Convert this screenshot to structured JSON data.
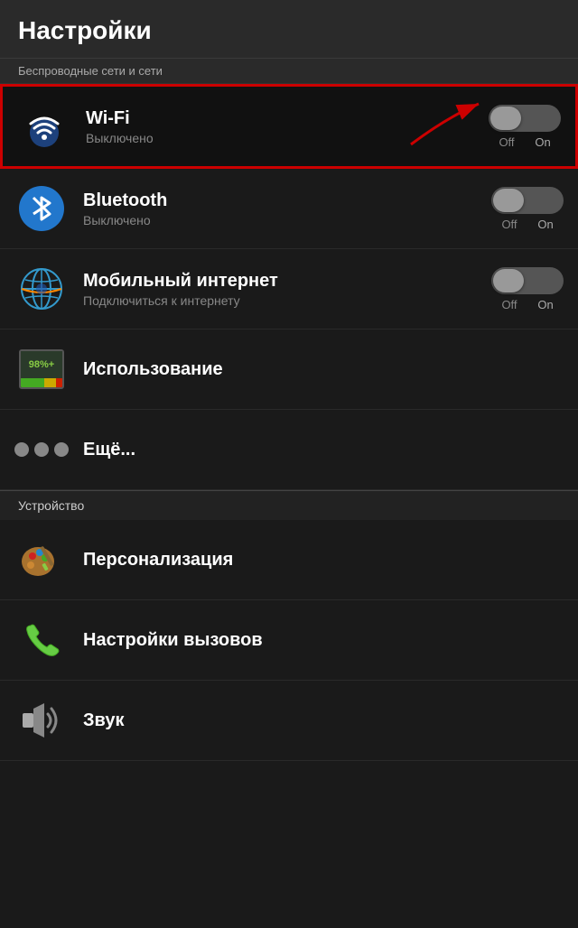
{
  "header": {
    "title": "Настройки"
  },
  "wireless_section": {
    "label": "Беспроводные сети и сети"
  },
  "items": {
    "wifi": {
      "title": "Wi-Fi",
      "subtitle": "Выключено",
      "toggle_off": "Off",
      "toggle_on": "On",
      "state": "off"
    },
    "bluetooth": {
      "title": "Bluetooth",
      "subtitle": "Выключено",
      "toggle_off": "Off",
      "toggle_on": "On",
      "state": "off"
    },
    "mobile": {
      "title": "Мобильный интернет",
      "subtitle": "Подключиться к интернету",
      "toggle_off": "Off",
      "toggle_on": "On",
      "state": "off"
    },
    "usage": {
      "title": "Использование",
      "usage_pct": "98%+"
    },
    "more": {
      "title": "Ещё..."
    }
  },
  "device_section": {
    "label": "Устройство"
  },
  "device_items": {
    "personalization": {
      "title": "Персонализация"
    },
    "calls": {
      "title": "Настройки вызовов"
    },
    "sound": {
      "title": "Звук"
    }
  }
}
